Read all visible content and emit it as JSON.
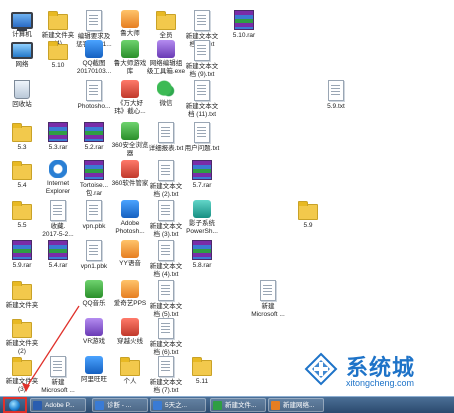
{
  "desktop": {
    "icons": [
      {
        "label": "计算机",
        "type": "computer"
      },
      {
        "label": "新建文件夹\n(4)",
        "type": "folder"
      },
      {
        "label": "编辑要求及\n惩罚 V201...",
        "type": "doc"
      },
      {
        "label": "鲁大师",
        "type": "app",
        "color": "orange"
      },
      {
        "label": "全员",
        "type": "folder"
      },
      {
        "label": "新建文本文\n档 (8).txt",
        "type": "doc"
      },
      {
        "label": "5.10.rar",
        "type": "rar"
      },
      {
        "label": "网络",
        "type": "network"
      },
      {
        "label": "5.10",
        "type": "folder"
      },
      {
        "label": "QQ截图\n20170103...",
        "type": "app",
        "color": "blue"
      },
      {
        "label": "鲁大师游戏\n库",
        "type": "app",
        "color": "green"
      },
      {
        "label": "网络编辑组\n级工具箱.exe",
        "type": "app",
        "color": "purple"
      },
      {
        "label": "新建文本文\n档 (9).txt",
        "type": "doc"
      },
      {
        "label": "回收站",
        "type": "recycle"
      },
      {
        "label": "Photosho...",
        "type": "doc"
      },
      {
        "label": "《万大好\n玮》截心...",
        "type": "app",
        "color": "red"
      },
      {
        "label": "微信",
        "type": "app",
        "color": "chat"
      },
      {
        "label": "新建文本文\n档 (11).txt",
        "type": "doc"
      },
      {
        "label": "5.9.txt",
        "type": "doc"
      },
      {
        "label": "5.3",
        "type": "folder"
      },
      {
        "label": "5.3.rar",
        "type": "rar"
      },
      {
        "label": "5.2.rar",
        "type": "rar"
      },
      {
        "label": "360安全浏览\n器",
        "type": "app",
        "color": "green"
      },
      {
        "label": "详细报表.txt",
        "type": "doc"
      },
      {
        "label": "用户问题.txt",
        "type": "doc"
      },
      {
        "label": "5.4",
        "type": "folder"
      },
      {
        "label": "Internet\nExplorer",
        "type": "app",
        "color": "ie"
      },
      {
        "label": "Tortoise...\n包.rar",
        "type": "rar"
      },
      {
        "label": "360软件管家",
        "type": "app",
        "color": "red"
      },
      {
        "label": "新建文本文\n档 (2).txt",
        "type": "doc"
      },
      {
        "label": "5.7.rar",
        "type": "rar"
      },
      {
        "label": "5.5",
        "type": "folder"
      },
      {
        "label": "收藏.\n2017-5-2...",
        "type": "doc"
      },
      {
        "label": "vpn.pbk",
        "type": "doc"
      },
      {
        "label": "Adobe\nPhotosh...",
        "type": "app",
        "color": "blue"
      },
      {
        "label": "新建文本文\n档 (3).txt",
        "type": "doc"
      },
      {
        "label": "影子系统\nPowerSh...",
        "type": "app",
        "color": "teal"
      },
      {
        "label": "5.9",
        "type": "folder"
      },
      {
        "label": "5.9.rar",
        "type": "rar"
      },
      {
        "label": "5.4.rar",
        "type": "rar"
      },
      {
        "label": "vpn1.pbk",
        "type": "doc"
      },
      {
        "label": "YY语音",
        "type": "app",
        "color": "orange"
      },
      {
        "label": "新建文本文\n档 (4).txt",
        "type": "doc"
      },
      {
        "label": "5.8.rar",
        "type": "rar"
      },
      {
        "label": "新建文件夹",
        "type": "folder"
      },
      {
        "label": "QQ音乐",
        "type": "app",
        "color": "green"
      },
      {
        "label": "爱奇艺PPS",
        "type": "app",
        "color": "orange"
      },
      {
        "label": "新建文本文\n档 (5).txt",
        "type": "doc"
      },
      {
        "label": "新建\nMicrosoft ...",
        "type": "doc"
      },
      {
        "label": "新建文件夹\n(2)",
        "type": "folder"
      },
      {
        "label": "VR游戏",
        "type": "app",
        "color": "purple"
      },
      {
        "label": "穿越火线",
        "type": "app",
        "color": "red"
      },
      {
        "label": "新建文本文\n档 (6).txt",
        "type": "doc"
      },
      {
        "label": "新建文件夹\n(3)",
        "type": "folder"
      },
      {
        "label": "新建\nMicrosoft ...",
        "type": "doc"
      },
      {
        "label": "阿里旺旺",
        "type": "app",
        "color": "blue"
      },
      {
        "label": "个人",
        "type": "folder"
      },
      {
        "label": "新建文本文\n档 (7).txt",
        "type": "doc"
      },
      {
        "label": "5.11",
        "type": "folder"
      }
    ]
  },
  "taskbar": {
    "tasks": [
      {
        "label": "Adobe P...",
        "color": "#2a5db0"
      },
      {
        "label": "诊断 - ...",
        "color": "#3a7bd5"
      },
      {
        "label": "5天之...",
        "color": "#3a7bd5"
      },
      {
        "label": "新建文件...",
        "color": "#2f9e44"
      },
      {
        "label": "新建网络...",
        "color": "#e67e22"
      }
    ]
  },
  "watermark": {
    "brand": "系统城",
    "url": "xitongcheng.com"
  }
}
